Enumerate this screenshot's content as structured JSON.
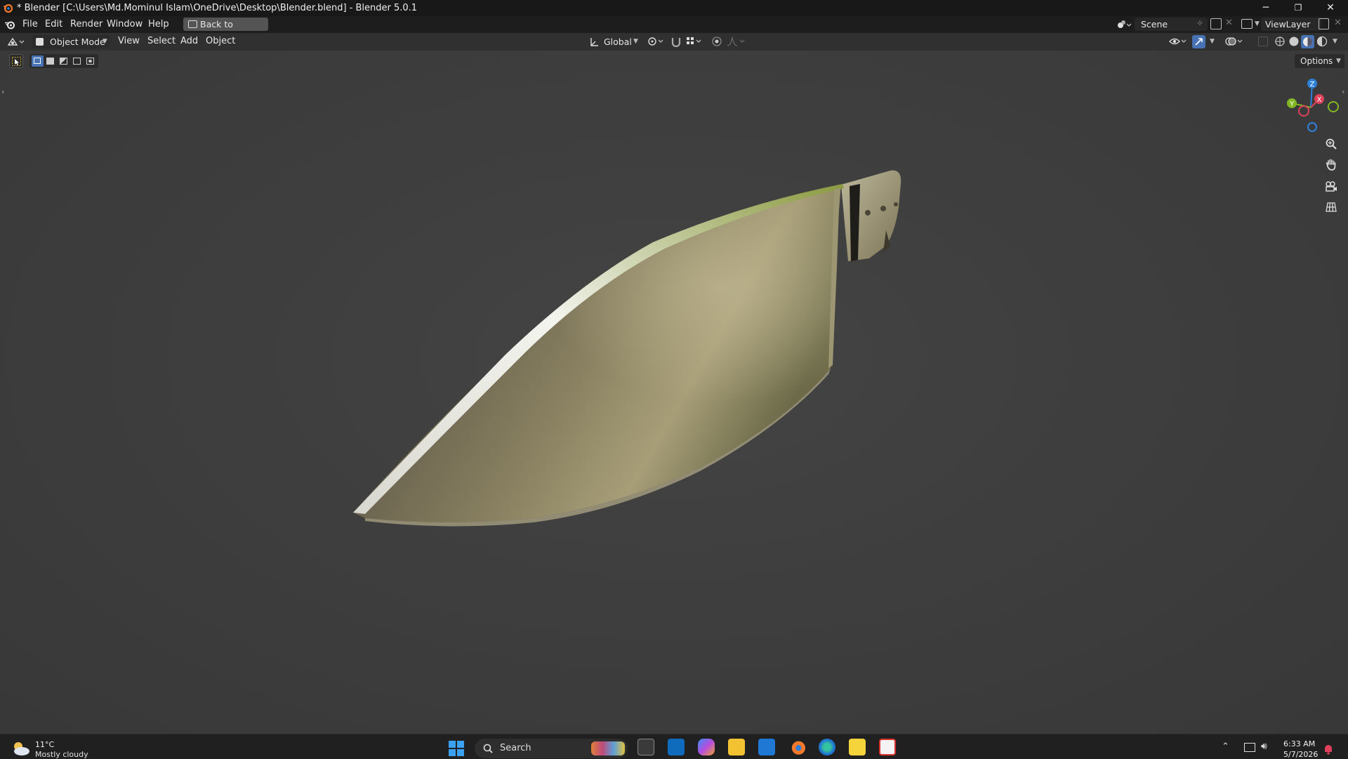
{
  "window": {
    "title": "* Blender [C:\\Users\\Md.Mominul Islam\\OneDrive\\Desktop\\Blender.blend] - Blender 5.0.1",
    "minimize": "─",
    "maximize": "❐",
    "close": "✕"
  },
  "menubar": {
    "items": [
      "File",
      "Edit",
      "Render",
      "Window",
      "Help"
    ],
    "back_button": "Back to Previous",
    "scene": "Scene",
    "view_layer": "ViewLayer"
  },
  "header": {
    "mode": "Object Mode",
    "menus": [
      "View",
      "Select",
      "Add",
      "Object"
    ],
    "transform_orientation": "Global"
  },
  "viewport": {
    "options_label": "Options",
    "gizmo_axes": {
      "x": "X",
      "y": "Y",
      "z": "Z"
    },
    "colors": {
      "x": "#e0415a",
      "y": "#82b723",
      "z": "#2e7fd8"
    }
  },
  "taskbar": {
    "weather": {
      "temp": "11°C",
      "condition": "Mostly cloudy"
    },
    "search_placeholder": "Search",
    "clock": {
      "time": "6:33 AM",
      "date": "5/7/2026"
    }
  },
  "colors": {
    "accent": "#4772b3",
    "blender_orange": "#f5792a"
  }
}
